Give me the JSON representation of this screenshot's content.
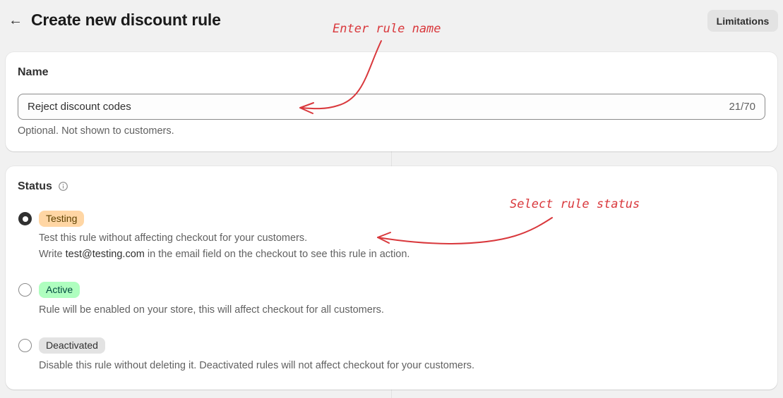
{
  "header": {
    "title": "Create new discount rule",
    "limitations_label": "Limitations"
  },
  "name_card": {
    "title": "Name",
    "input_value": "Reject discount codes",
    "char_count": "21/70",
    "help_text": "Optional. Not shown to customers."
  },
  "status_card": {
    "title": "Status",
    "options": [
      {
        "badge": "Testing",
        "badge_bg": "#ffd6a4",
        "badge_color": "#5e4200",
        "selected": true,
        "line1": "Test this rule without affecting checkout for your customers.",
        "line2_pre": "Write ",
        "line2_email": "test@testing.com",
        "line2_post": " in the email field on the checkout to see this rule in action."
      },
      {
        "badge": "Active",
        "badge_bg": "#affebf",
        "badge_color": "#014b40",
        "selected": false,
        "line1": "Rule will be enabled on your store, this will affect checkout for all customers."
      },
      {
        "badge": "Deactivated",
        "badge_bg": "#e3e3e3",
        "badge_color": "#303030",
        "selected": false,
        "line1": "Disable this rule without deleting it. Deactivated rules will not affect checkout for your customers."
      }
    ]
  },
  "annotations": {
    "name_hint": "Enter rule name",
    "status_hint": "Select rule status",
    "color": "#d9383c"
  },
  "icons": {
    "back": "arrow-left-icon",
    "info": "info-circle-icon"
  }
}
